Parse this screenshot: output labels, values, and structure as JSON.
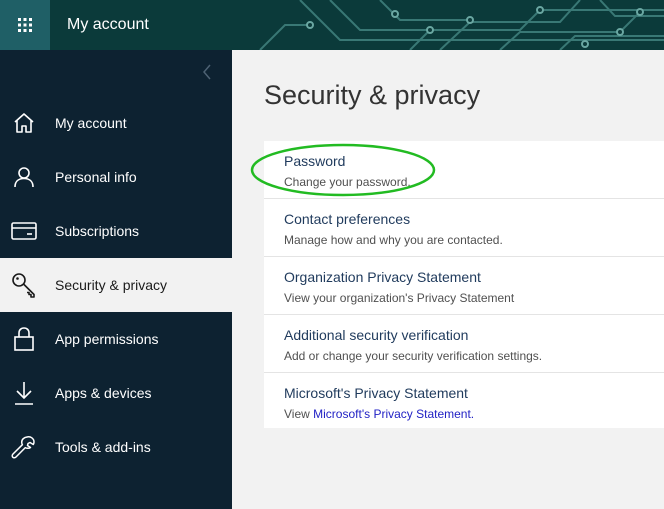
{
  "header": {
    "app_title": "My account",
    "waffle_icon": "app-launcher-icon"
  },
  "sidebar": {
    "collapse_icon": "chevron-left-icon",
    "items": [
      {
        "label": "My account",
        "icon": "home-icon",
        "active": false
      },
      {
        "label": "Personal info",
        "icon": "person-icon",
        "active": false
      },
      {
        "label": "Subscriptions",
        "icon": "card-icon",
        "active": false
      },
      {
        "label": "Security & privacy",
        "icon": "key-icon",
        "active": true
      },
      {
        "label": "App permissions",
        "icon": "lock-icon",
        "active": false
      },
      {
        "label": "Apps & devices",
        "icon": "download-icon",
        "active": false
      },
      {
        "label": "Tools & add-ins",
        "icon": "wrench-icon",
        "active": false
      }
    ]
  },
  "main": {
    "title": "Security & privacy",
    "rows": [
      {
        "title": "Password",
        "desc": "Change your password."
      },
      {
        "title": "Contact preferences",
        "desc": "Manage how and why you are contacted."
      },
      {
        "title": "Organization Privacy Statement",
        "desc": "View your organization's Privacy Statement"
      },
      {
        "title": "Additional security verification",
        "desc": "Add or change your security verification settings."
      },
      {
        "title": "Microsoft's Privacy Statement",
        "desc_prefix": "View ",
        "desc_link": "Microsoft's Privacy Statement."
      }
    ]
  },
  "colors": {
    "header_bg": "#0b3a3a",
    "sidebar_bg": "#0d2231",
    "active_bg": "#f2f2f2",
    "annotation": "#22bb22",
    "link": "#1f1fc4"
  }
}
